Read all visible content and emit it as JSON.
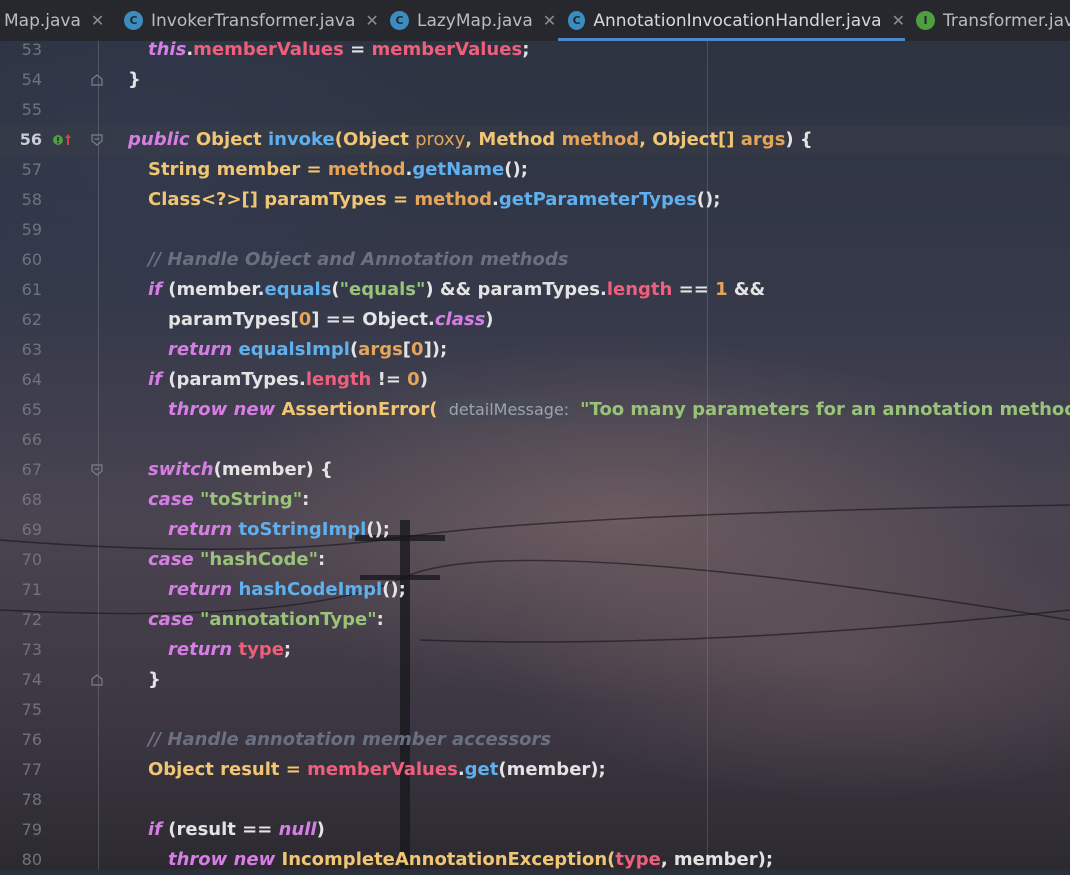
{
  "tabs": [
    {
      "label": "Map.java",
      "icon": "none",
      "active": false
    },
    {
      "label": "InvokerTransformer.java",
      "icon": "class-icon",
      "active": false
    },
    {
      "label": "LazyMap.java",
      "icon": "class-icon",
      "active": false
    },
    {
      "label": "AnnotationInvocationHandler.java",
      "icon": "class-icon",
      "active": true
    },
    {
      "label": "Transformer.java",
      "icon": "interface-icon",
      "active": false
    }
  ],
  "icon_letters": {
    "class": "C",
    "interface": "I"
  },
  "colors": {
    "keyword": "#d77ee6",
    "function": "#5fb0ef",
    "field": "#ef5f7b",
    "string": "#98c379",
    "number": "#e4a55b",
    "comment": "#6b7080",
    "tab_underline": "#4a88c7"
  },
  "gutter_icons": {
    "line_56": "implementation-up-arrow-icon"
  },
  "editor": {
    "current_line": "56",
    "lines": [
      {
        "n": "53"
      },
      {
        "n": "54"
      },
      {
        "n": "55"
      },
      {
        "n": "56"
      },
      {
        "n": "57"
      },
      {
        "n": "58"
      },
      {
        "n": "59"
      },
      {
        "n": "60"
      },
      {
        "n": "61"
      },
      {
        "n": "62"
      },
      {
        "n": "63"
      },
      {
        "n": "64"
      },
      {
        "n": "65"
      },
      {
        "n": "66"
      },
      {
        "n": "67"
      },
      {
        "n": "68"
      },
      {
        "n": "69"
      },
      {
        "n": "70"
      },
      {
        "n": "71"
      },
      {
        "n": "72"
      },
      {
        "n": "73"
      },
      {
        "n": "74"
      },
      {
        "n": "75"
      },
      {
        "n": "76"
      },
      {
        "n": "77"
      },
      {
        "n": "78"
      },
      {
        "n": "79"
      },
      {
        "n": "80"
      }
    ],
    "tokens": {
      "l53": [
        "this",
        ".",
        "memberValues",
        " = ",
        "memberValues",
        ";"
      ],
      "l54": [
        "}"
      ],
      "l56": [
        "public",
        " Object ",
        "invoke",
        "(Object ",
        "proxy",
        ", Method ",
        "method",
        ", Object[] ",
        "args",
        ") {"
      ],
      "l57": [
        "String member = ",
        "method",
        ".",
        "getName",
        "();"
      ],
      "l58": [
        "Class<?>[] paramTypes = ",
        "method",
        ".",
        "getParameterTypes",
        "();"
      ],
      "l60": [
        "// Handle Object and Annotation methods"
      ],
      "l61": [
        "if",
        " (member.",
        "equals",
        "(",
        "\"equals\"",
        ") && paramTypes.",
        "length",
        " == ",
        "1",
        " &&"
      ],
      "l62": [
        "paramTypes[",
        "0",
        "] == Object.",
        "class",
        ")"
      ],
      "l63": [
        "return",
        " ",
        "equalsImpl",
        "(",
        "args",
        "[",
        "0",
        "]);"
      ],
      "l64": [
        "if",
        " (paramTypes.",
        "length",
        " != ",
        "0",
        ")"
      ],
      "l65": [
        "throw",
        " ",
        "new",
        " AssertionError( ",
        "detailMessage:",
        "\"Too many parameters for an annotation method\"",
        ");"
      ],
      "l67": [
        "switch",
        "(member) {"
      ],
      "l68": [
        "case",
        " ",
        "\"toString\"",
        ":"
      ],
      "l69": [
        "return",
        " ",
        "toStringImpl",
        "();"
      ],
      "l70": [
        "case",
        " ",
        "\"hashCode\"",
        ":"
      ],
      "l71": [
        "return",
        " ",
        "hashCodeImpl",
        "();"
      ],
      "l72": [
        "case",
        " ",
        "\"annotationType\"",
        ":"
      ],
      "l73": [
        "return",
        " ",
        "type",
        ";"
      ],
      "l74": [
        "}"
      ],
      "l76": [
        "// Handle annotation member accessors"
      ],
      "l77": [
        "Object result = ",
        "memberValues",
        ".",
        "get",
        "(member);"
      ],
      "l79": [
        "if",
        " (result == ",
        "null",
        ")"
      ],
      "l80": [
        "throw",
        " ",
        "new",
        " IncompleteAnnotationException(",
        "type",
        ", member);"
      ]
    }
  }
}
